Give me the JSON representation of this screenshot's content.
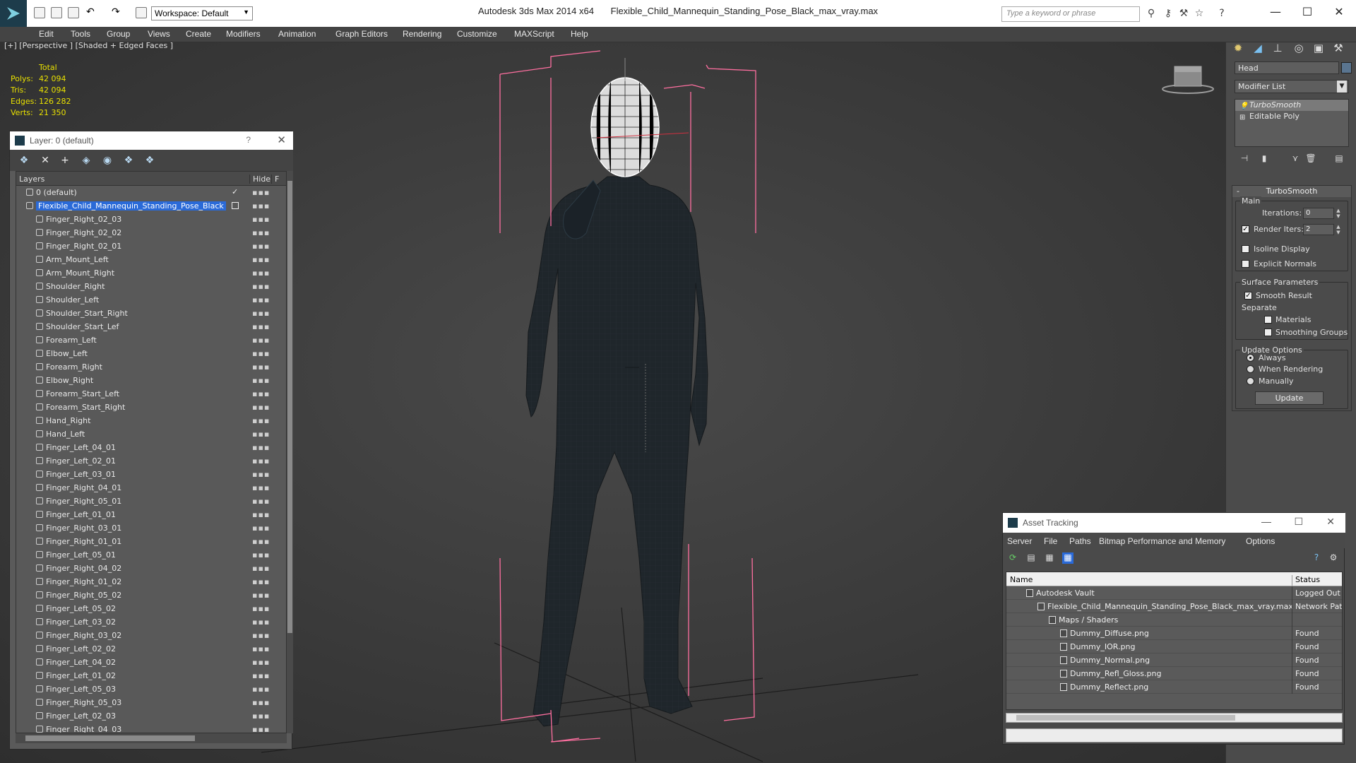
{
  "titlebar": {
    "app_name": "Autodesk 3ds Max  2014 x64",
    "file_name": "Flexible_Child_Mannequin_Standing_Pose_Black_max_vray.max",
    "workspace": "Workspace: Default",
    "search_placeholder": "Type a keyword or phrase"
  },
  "menu": [
    "Edit",
    "Tools",
    "Group",
    "Views",
    "Create",
    "Modifiers",
    "Animation",
    "Graph Editors",
    "Rendering",
    "Customize",
    "MAXScript",
    "Help"
  ],
  "viewport": {
    "label": "[+] [Perspective ] [Shaded + Edged Faces ]",
    "stats": {
      "header": "Total",
      "rows": [
        {
          "label": "Polys:",
          "value": "42 094"
        },
        {
          "label": "Tris:",
          "value": "42 094"
        },
        {
          "label": "Edges:",
          "value": "126 282"
        },
        {
          "label": "Verts:",
          "value": "21 350"
        }
      ]
    }
  },
  "layer_window": {
    "title": "Layer: 0 (default)",
    "help": "?",
    "columns": {
      "layers": "Layers",
      "hide": "Hide",
      "freeze": "F"
    },
    "layers": [
      {
        "name": "0 (default)",
        "level": 0,
        "type": "layer"
      },
      {
        "name": "Flexible_Child_Mannequin_Standing_Pose_Black",
        "level": 0,
        "type": "layer",
        "selected": true
      },
      {
        "name": "Finger_Right_02_03",
        "level": 1
      },
      {
        "name": "Finger_Right_02_02",
        "level": 1
      },
      {
        "name": "Finger_Right_02_01",
        "level": 1
      },
      {
        "name": "Arm_Mount_Left",
        "level": 1
      },
      {
        "name": "Arm_Mount_Right",
        "level": 1
      },
      {
        "name": "Shoulder_Right",
        "level": 1
      },
      {
        "name": "Shoulder_Left",
        "level": 1
      },
      {
        "name": "Shoulder_Start_Right",
        "level": 1
      },
      {
        "name": "Shoulder_Start_Lef",
        "level": 1
      },
      {
        "name": "Forearm_Left",
        "level": 1
      },
      {
        "name": "Elbow_Left",
        "level": 1
      },
      {
        "name": "Forearm_Right",
        "level": 1
      },
      {
        "name": "Elbow_Right",
        "level": 1
      },
      {
        "name": "Forearm_Start_Left",
        "level": 1
      },
      {
        "name": "Forearm_Start_Right",
        "level": 1
      },
      {
        "name": "Hand_Right",
        "level": 1
      },
      {
        "name": "Hand_Left",
        "level": 1
      },
      {
        "name": "Finger_Left_04_01",
        "level": 1
      },
      {
        "name": "Finger_Left_02_01",
        "level": 1
      },
      {
        "name": "Finger_Left_03_01",
        "level": 1
      },
      {
        "name": "Finger_Right_04_01",
        "level": 1
      },
      {
        "name": "Finger_Right_05_01",
        "level": 1
      },
      {
        "name": "Finger_Left_01_01",
        "level": 1
      },
      {
        "name": "Finger_Right_03_01",
        "level": 1
      },
      {
        "name": "Finger_Right_01_01",
        "level": 1
      },
      {
        "name": "Finger_Left_05_01",
        "level": 1
      },
      {
        "name": "Finger_Right_04_02",
        "level": 1
      },
      {
        "name": "Finger_Right_01_02",
        "level": 1
      },
      {
        "name": "Finger_Right_05_02",
        "level": 1
      },
      {
        "name": "Finger_Left_05_02",
        "level": 1
      },
      {
        "name": "Finger_Left_03_02",
        "level": 1
      },
      {
        "name": "Finger_Right_03_02",
        "level": 1
      },
      {
        "name": "Finger_Left_02_02",
        "level": 1
      },
      {
        "name": "Finger_Left_04_02",
        "level": 1
      },
      {
        "name": "Finger_Left_01_02",
        "level": 1
      },
      {
        "name": "Finger_Left_05_03",
        "level": 1
      },
      {
        "name": "Finger_Right_05_03",
        "level": 1
      },
      {
        "name": "Finger_Left_02_03",
        "level": 1
      },
      {
        "name": "Finger_Right_04_03",
        "level": 1
      }
    ]
  },
  "command_panel": {
    "object_name": "Head",
    "object_color": "#5a7590",
    "modifier_list": "Modifier List",
    "stack": [
      "TurboSmooth",
      "Editable Poly"
    ],
    "turbosmooth": {
      "title": "TurboSmooth",
      "main": "Main",
      "iterations_label": "Iterations:",
      "iterations": "0",
      "render_iters_label": "Render Iters:",
      "render_iters": "2",
      "isoline": "Isoline Display",
      "explicit_normals": "Explicit Normals",
      "surface_params": "Surface Parameters",
      "smooth_result": "Smooth Result",
      "separate": "Separate",
      "materials": "Materials",
      "smoothing_groups": "Smoothing Groups",
      "update_options": "Update Options",
      "always": "Always",
      "when_rendering": "When Rendering",
      "manually": "Manually",
      "update_button": "Update"
    }
  },
  "asset_tracking": {
    "title": "Asset Tracking",
    "menu": [
      "Server",
      "File",
      "Paths",
      "Bitmap Performance and Memory",
      "Options"
    ],
    "columns": {
      "name": "Name",
      "status": "Status"
    },
    "rows": [
      {
        "name": "Autodesk Vault",
        "status": "Logged Out",
        "indent": 1
      },
      {
        "name": "Flexible_Child_Mannequin_Standing_Pose_Black_max_vray.max",
        "status": "Network Pat",
        "indent": 2
      },
      {
        "name": "Maps / Shaders",
        "status": "",
        "indent": 3
      },
      {
        "name": "Dummy_Diffuse.png",
        "status": "Found",
        "indent": 4
      },
      {
        "name": "Dummy_IOR.png",
        "status": "Found",
        "indent": 4
      },
      {
        "name": "Dummy_Normal.png",
        "status": "Found",
        "indent": 4
      },
      {
        "name": "Dummy_Refl_Gloss.png",
        "status": "Found",
        "indent": 4
      },
      {
        "name": "Dummy_Reflect.png",
        "status": "Found",
        "indent": 4
      }
    ]
  },
  "colors": {
    "selection": "#2a6ad8",
    "stats_text": "#e8e000",
    "bounding_box": "#ff6fa0",
    "mannequin": "#1f262b"
  }
}
